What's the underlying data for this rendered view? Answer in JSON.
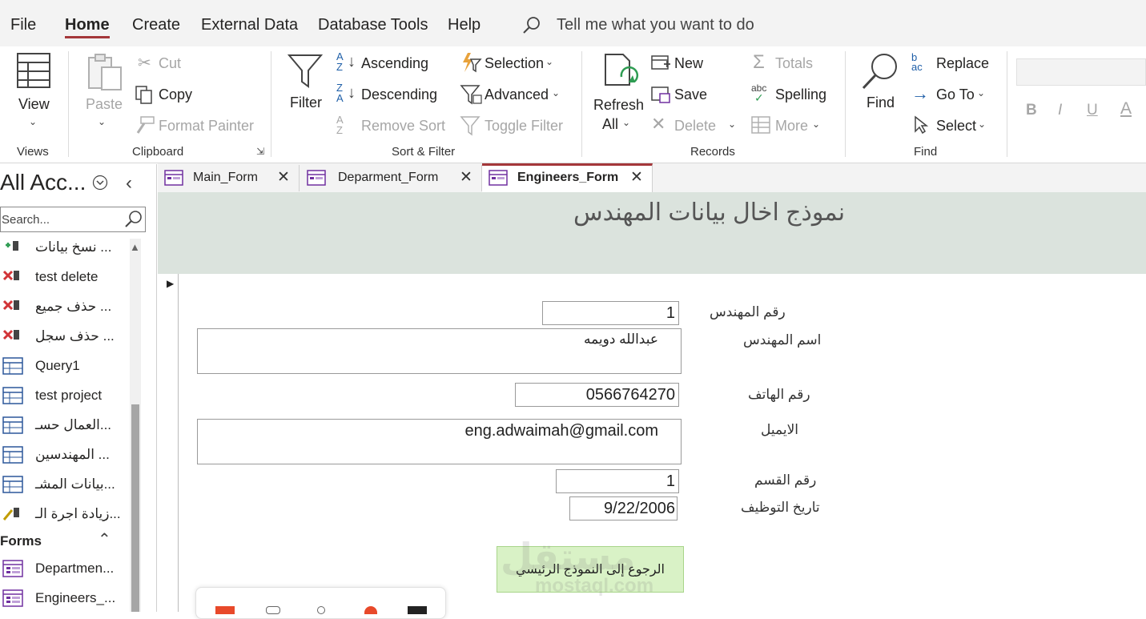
{
  "menu": {
    "items": [
      "File",
      "Home",
      "Create",
      "External Data",
      "Database Tools",
      "Help"
    ],
    "tell_me": "Tell me what you want to do"
  },
  "ribbon": {
    "views": {
      "view": "View",
      "group": "Views"
    },
    "clipboard": {
      "paste": "Paste",
      "cut": "Cut",
      "copy": "Copy",
      "format_painter": "Format Painter",
      "group": "Clipboard"
    },
    "sort_filter": {
      "filter": "Filter",
      "ascending": "Ascending",
      "descending": "Descending",
      "remove_sort": "Remove Sort",
      "selection": "Selection",
      "advanced": "Advanced",
      "toggle_filter": "Toggle Filter",
      "group": "Sort & Filter"
    },
    "records": {
      "refresh": "Refresh",
      "all": "All",
      "new": "New",
      "save": "Save",
      "delete": "Delete",
      "totals": "Totals",
      "spelling": "Spelling",
      "more": "More",
      "group": "Records"
    },
    "find": {
      "find": "Find",
      "replace": "Replace",
      "goto": "Go To",
      "select": "Select",
      "group": "Find"
    },
    "format": {
      "bold": "B",
      "italic": "I",
      "underline": "U",
      "font_color": "A"
    }
  },
  "nav": {
    "title": "All Acc...",
    "search_placeholder": "Search...",
    "items": [
      "نسخ بيانات ...",
      "test delete",
      "حذف جميع ...",
      "حذف سجل ...",
      "Query1",
      "test project",
      "العمال حسـ...",
      "المهندسين ...",
      "بيانات المشـ...",
      "زيادة اجرة الـ..."
    ],
    "forms_header": "Forms",
    "forms": [
      "Departmen...",
      "Engineers_..."
    ]
  },
  "tabs": [
    "Main_Form",
    "Deparment_Form",
    "Engineers_Form"
  ],
  "form": {
    "title": "نموذج اخال بيانات المهندس",
    "fields": {
      "engineer_no": {
        "label": "رقم المهندس",
        "value": "1"
      },
      "engineer_name": {
        "label": "اسم المهندس",
        "value": "عبدالله دويمه"
      },
      "phone": {
        "label": "رقم الهاتف",
        "value": "0566764270"
      },
      "email": {
        "label": "الايميل",
        "value": "eng.adwaimah@gmail.com"
      },
      "dept_no": {
        "label": "رقم القسم",
        "value": "1"
      },
      "hire_date": {
        "label": "تاريخ التوظيف",
        "value": "9/22/2006"
      }
    },
    "back_button": "الرجوع إلى النموذج الرئيسي"
  },
  "watermark": {
    "arabic": "مستقل",
    "latin": "mostaql.com"
  },
  "colors": {
    "accent": "#a4373a",
    "header_bg": "#dbe3dd",
    "button_bg": "#d9f2c6"
  }
}
